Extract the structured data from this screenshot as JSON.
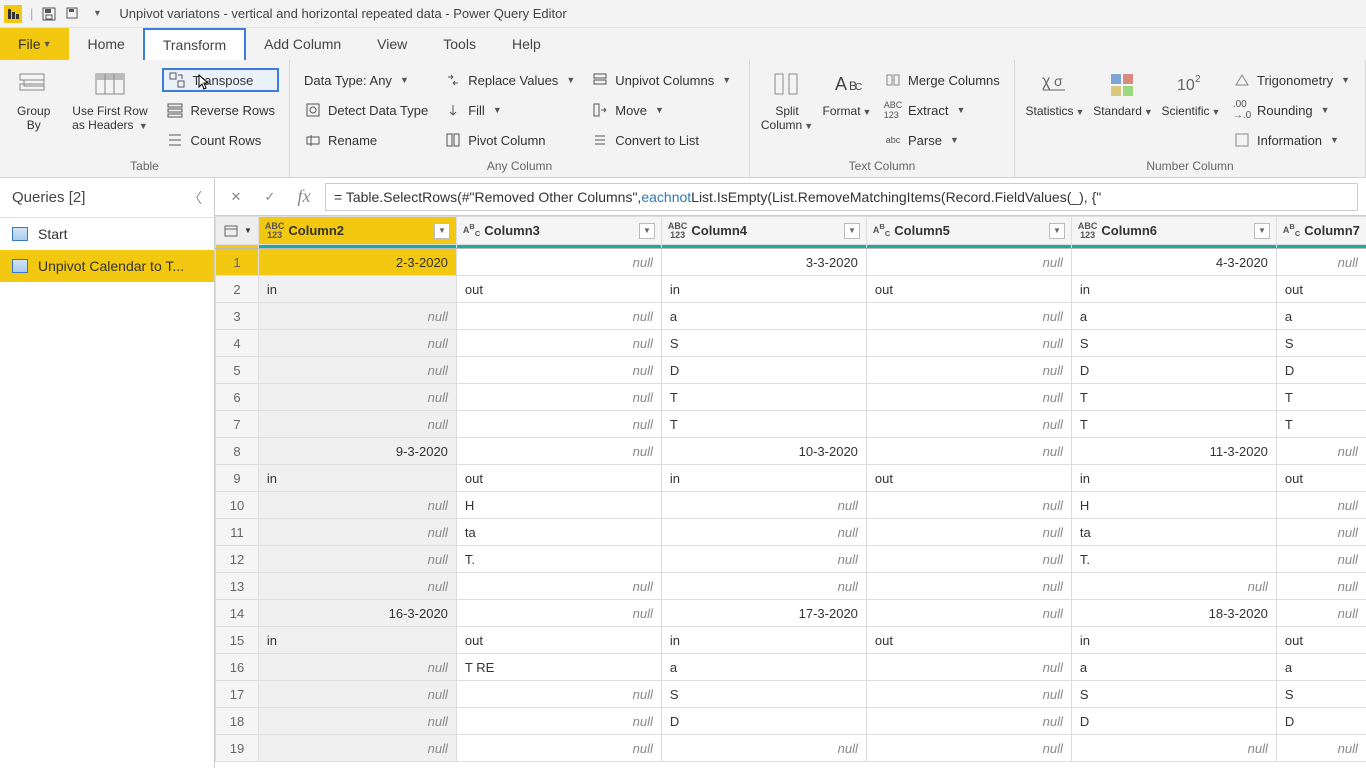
{
  "title_bar": {
    "app_title": "Unpivot variatons  - vertical and horizontal repeated data - Power Query Editor"
  },
  "tabs": {
    "file": "File",
    "home": "Home",
    "transform": "Transform",
    "add_column": "Add Column",
    "view": "View",
    "tools": "Tools",
    "help": "Help"
  },
  "ribbon": {
    "group_table": "Table",
    "group_any_column": "Any Column",
    "group_text_column": "Text Column",
    "group_number_column": "Number Column",
    "group_by": "Group By",
    "use_first_row": "Use First Row as Headers",
    "transpose": "Transpose",
    "reverse_rows": "Reverse Rows",
    "count_rows": "Count Rows",
    "data_type": "Data Type: Any",
    "detect_data_type": "Detect Data Type",
    "rename": "Rename",
    "replace_values": "Replace Values",
    "fill": "Fill",
    "pivot_column": "Pivot Column",
    "unpivot_columns": "Unpivot Columns",
    "move": "Move",
    "convert_to_list": "Convert to List",
    "split_column": "Split Column",
    "format": "Format",
    "merge_columns": "Merge Columns",
    "extract": "Extract",
    "parse": "Parse",
    "statistics": "Statistics",
    "standard": "Standard",
    "scientific": "Scientific",
    "trigonometry": "Trigonometry",
    "rounding": "Rounding",
    "information": "Information"
  },
  "queries": {
    "header": "Queries [2]",
    "items": [
      "Start",
      "Unpivot Calendar to T..."
    ]
  },
  "formula_bar": {
    "prefix": "= Table.SelectRows(#\"Removed Other Columns\", ",
    "each": "each",
    "not": " not",
    "suffix": " List.IsEmpty(List.RemoveMatchingItems(Record.FieldValues(_), {\""
  },
  "grid": {
    "columns": [
      "Column2",
      "Column3",
      "Column4",
      "Column5",
      "Column6",
      "Column7"
    ],
    "rows": [
      {
        "n": 1,
        "c": [
          "2-3-2020",
          null,
          "3-3-2020",
          null,
          "4-3-2020",
          null
        ],
        "align": [
          "r",
          "r",
          "r",
          "r",
          "r",
          "r"
        ]
      },
      {
        "n": 2,
        "c": [
          "in",
          "out",
          "in",
          "out",
          "in",
          "out"
        ]
      },
      {
        "n": 3,
        "c": [
          null,
          null,
          "a",
          null,
          "a",
          "a"
        ]
      },
      {
        "n": 4,
        "c": [
          null,
          null,
          "S",
          null,
          "S",
          "S"
        ]
      },
      {
        "n": 5,
        "c": [
          null,
          null,
          "D",
          null,
          "D",
          "D"
        ]
      },
      {
        "n": 6,
        "c": [
          null,
          null,
          "T",
          null,
          "T",
          "T"
        ]
      },
      {
        "n": 7,
        "c": [
          null,
          null,
          "T",
          null,
          "T",
          "T"
        ]
      },
      {
        "n": 8,
        "c": [
          "9-3-2020",
          null,
          "10-3-2020",
          null,
          "11-3-2020",
          null
        ],
        "align": [
          "r",
          "r",
          "r",
          "r",
          "r",
          "r"
        ]
      },
      {
        "n": 9,
        "c": [
          "in",
          "out",
          "in",
          "out",
          "in",
          "out"
        ]
      },
      {
        "n": 10,
        "c": [
          null,
          "H",
          null,
          null,
          "H",
          null
        ]
      },
      {
        "n": 11,
        "c": [
          null,
          "ta",
          null,
          null,
          "ta",
          null
        ]
      },
      {
        "n": 12,
        "c": [
          null,
          "T.",
          null,
          null,
          "T.",
          null
        ]
      },
      {
        "n": 13,
        "c": [
          null,
          null,
          null,
          null,
          null,
          null
        ],
        "align": [
          "r",
          "r",
          "r",
          "r",
          "r",
          "r"
        ]
      },
      {
        "n": 14,
        "c": [
          "16-3-2020",
          null,
          "17-3-2020",
          null,
          "18-3-2020",
          null
        ],
        "align": [
          "r",
          "r",
          "r",
          "r",
          "r",
          "r"
        ]
      },
      {
        "n": 15,
        "c": [
          "in",
          "out",
          "in",
          "out",
          "in",
          "out"
        ]
      },
      {
        "n": 16,
        "c": [
          null,
          "T RE",
          "a",
          null,
          "a",
          "a"
        ]
      },
      {
        "n": 17,
        "c": [
          null,
          null,
          "S",
          null,
          "S",
          "S"
        ]
      },
      {
        "n": 18,
        "c": [
          null,
          null,
          "D",
          null,
          "D",
          "D"
        ]
      },
      {
        "n": 19,
        "c": [
          null,
          null,
          null,
          null,
          null,
          null
        ]
      }
    ]
  }
}
